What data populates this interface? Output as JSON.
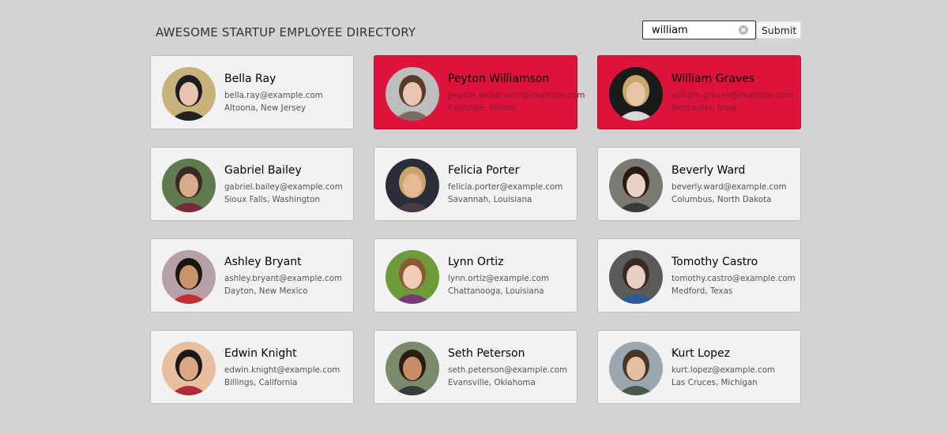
{
  "header": {
    "title": "AWESOME STARTUP EMPLOYEE DIRECTORY"
  },
  "search": {
    "value": "william",
    "submit_label": "Submit"
  },
  "colors": {
    "background": "#d3d3d3",
    "card": "#f2f2f2",
    "highlight": "#dc143c"
  },
  "employees": [
    {
      "name": "Bella Ray",
      "email": "bella.ray@example.com",
      "location": "Altoona, New Jersey",
      "highlighted": false
    },
    {
      "name": "Peyton Williamson",
      "email": "peyton.williamson@example.com",
      "location": "Palmdale, Illinois",
      "highlighted": true
    },
    {
      "name": "William Graves",
      "email": "william.graves@example.com",
      "location": "Worcester, Iowa",
      "highlighted": true
    },
    {
      "name": "Gabriel Bailey",
      "email": "gabriel.bailey@example.com",
      "location": "Sioux Falls, Washington",
      "highlighted": false
    },
    {
      "name": "Felicia Porter",
      "email": "felicia.porter@example.com",
      "location": "Savannah, Louisiana",
      "highlighted": false
    },
    {
      "name": "Beverly Ward",
      "email": "beverly.ward@example.com",
      "location": "Columbus, North Dakota",
      "highlighted": false
    },
    {
      "name": "Ashley Bryant",
      "email": "ashley.bryant@example.com",
      "location": "Dayton, New Mexico",
      "highlighted": false
    },
    {
      "name": "Lynn Ortiz",
      "email": "lynn.ortiz@example.com",
      "location": "Chattanooga, Louisiana",
      "highlighted": false
    },
    {
      "name": "Tomothy Castro",
      "email": "tomothy.castro@example.com",
      "location": "Medford, Texas",
      "highlighted": false
    },
    {
      "name": "Edwin Knight",
      "email": "edwin.knight@example.com",
      "location": "Billings, California",
      "highlighted": false
    },
    {
      "name": "Seth Peterson",
      "email": "seth.peterson@example.com",
      "location": "Evansville, Oklahoma",
      "highlighted": false
    },
    {
      "name": "Kurt Lopez",
      "email": "kurt.lopez@example.com",
      "location": "Las Cruces, Michigan",
      "highlighted": false
    }
  ]
}
